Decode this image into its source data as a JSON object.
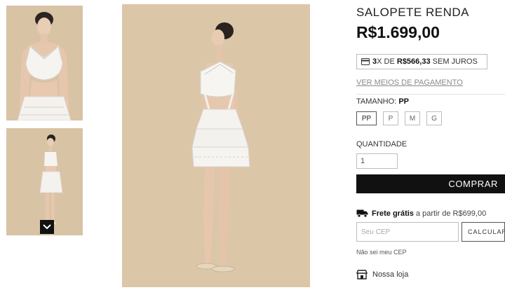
{
  "gallery": {
    "thumbnails": [
      "thumb-front-closeup",
      "thumb-side-full"
    ],
    "scroll_down_icon": "chevron-down-icon",
    "background_color": "#d8c3a5"
  },
  "product": {
    "title": "SALOPETE RENDA",
    "price": "R$1.699,00",
    "installments": {
      "count": "3",
      "prefix_suffix": "X DE",
      "amount": "R$566,33",
      "suffix": "SEM JUROS",
      "icon": "credit-card-icon"
    },
    "payment_link": "VER MEIOS DE PAGAMENTO",
    "size": {
      "label": "TAMANHO:",
      "selected": "PP",
      "options": [
        "PP",
        "P",
        "M",
        "G"
      ]
    },
    "quantity": {
      "label": "QUANTIDADE",
      "value": "1"
    },
    "buy_label": "COMPRAR"
  },
  "shipping": {
    "icon": "truck-icon",
    "free_label": "Frete grátis",
    "free_rest": "a partir de R$699,00",
    "cep_placeholder": "Seu CEP",
    "calculate_label": "CALCULAR",
    "no_cep_link": "Não sei meu CEP"
  },
  "store": {
    "icon": "store-icon",
    "label": "Nossa loja"
  }
}
